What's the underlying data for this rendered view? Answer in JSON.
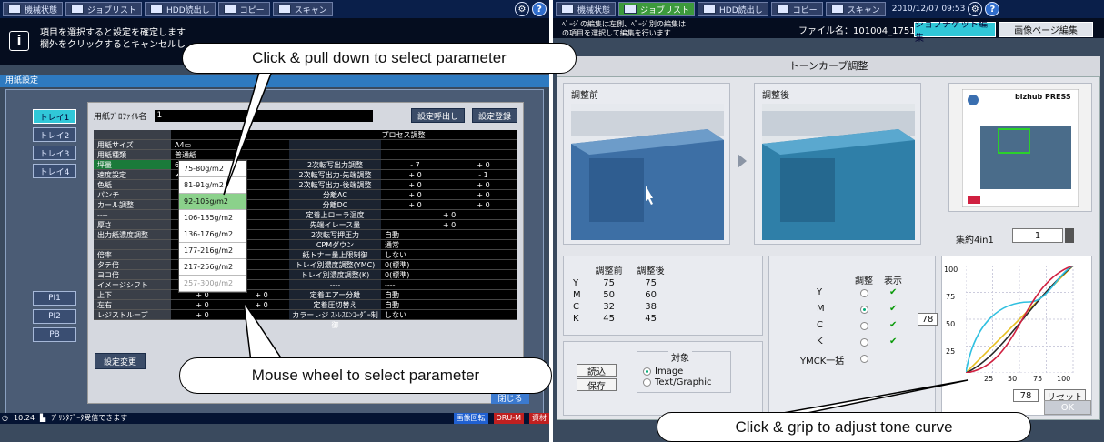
{
  "left": {
    "topbar": {
      "tabs": [
        "機械状態",
        "ジョブリスト",
        "HDD読出し",
        "コピー",
        "スキャン"
      ],
      "icons": [
        "machine-state-icon",
        "job-list-icon",
        "hdd-icon",
        "copy-icon",
        "scan-icon"
      ]
    },
    "message": [
      "項目を選択すると設定を確定します",
      "欄外をクリックするとキャンセルし"
    ],
    "title": "用紙設定",
    "trays": [
      "トレイ1",
      "トレイ2",
      "トレイ3",
      "トレイ4"
    ],
    "pi_buttons": [
      "PI1",
      "PI2",
      "PB"
    ],
    "profile_label": "用紙ﾌﾟﾛﾌｧｲﾙ名",
    "profile_value": "1",
    "call_button": "設定呼出し",
    "register_button": "設定登録",
    "rows": [
      {
        "k": "用紙サイズ",
        "v": "A4▭",
        "p": "",
        "a": "",
        "b": ""
      },
      {
        "k": "用紙種類",
        "v": "普通紙",
        "p": "",
        "a": "",
        "b": ""
      },
      {
        "k": "坪量",
        "v": "62-74g/m2",
        "p": "2次転写出力調整",
        "a": "- 7",
        "b": "+ 0"
      },
      {
        "k": "速度設定",
        "v": "✔62-74g/m2",
        "p": "2次転写出力-先端調整",
        "a": "+ 0",
        "b": "- 1"
      },
      {
        "k": "色紙",
        "v": "",
        "p": "2次転写出力-後端調整",
        "a": "+ 0",
        "b": "+ 0"
      },
      {
        "k": "パンチ",
        "v": "",
        "p": "分離AC",
        "a": "+ 0",
        "b": "+ 0"
      },
      {
        "k": "カール調整",
        "v": "",
        "p": "分離DC",
        "a": "+ 0",
        "b": "+ 0"
      },
      {
        "k": "----",
        "v": "",
        "p": "定着上ローラ温度",
        "ab": "+ 0"
      },
      {
        "k": "厚さ",
        "v": "",
        "p": "先端イレース量",
        "ab": "+ 0"
      },
      {
        "k": "出力紙濃度調整",
        "v": "",
        "p": "2次転写押圧力",
        "w": "自動"
      },
      {
        "k": "",
        "v": "",
        "p": "CPMダウン",
        "w": "通常"
      },
      {
        "k": "倍率",
        "v": "",
        "p": "紙トナー量上限制御",
        "w": "しない"
      },
      {
        "k": "タテ倍",
        "v": "",
        "p": "トレイ別濃度調整(YMC)",
        "w": "0(標準)"
      },
      {
        "k": "ヨコ倍",
        "v": "",
        "p": "トレイ別濃度調整(K)",
        "w": "0(標準)"
      },
      {
        "k": "イメージシフト",
        "v": "",
        "p": "----",
        "w": "----"
      },
      {
        "k": "上下",
        "v": "+ 0",
        "v2": "+ 0",
        "p": "定着エアー分離",
        "w": "自動"
      },
      {
        "k": "左右",
        "v": "+ 0",
        "v2": "+ 0",
        "p": "定着圧切替え",
        "w": "自動"
      },
      {
        "k": "レジストループ",
        "v": "+ 0",
        "v2": "",
        "p": "カラーレジ ｽﾄﾚｽｴﾝｺｰﾀﾞｰ制御",
        "w": "しない"
      }
    ],
    "process_header": "プロセス調整",
    "dropdown": [
      "75-80g/m2",
      "81-91g/m2",
      "92-105g/m2",
      "106-135g/m2",
      "136-176g/m2",
      "177-216g/m2",
      "217-256g/m2",
      "257-300g/m2"
    ],
    "dropdown_highlight": "92-105g/m2",
    "change_button": "設定変更",
    "close_button": "閉じる",
    "status_time": "10:24",
    "status_text": "ﾌﾟﾘﾝﾀﾃﾞｰﾀ受信できます",
    "status_b1": "画像回転",
    "status_b2": "ORU-M",
    "status_b3": "資材"
  },
  "right": {
    "topbar": {
      "tabs": [
        "機械状態",
        "ジョブリスト",
        "HDD読出し",
        "コピー",
        "スキャン"
      ],
      "datetime": "2010/12/07 09:53"
    },
    "message": [
      "ﾍﾟｰｼﾞの編集は左側、ﾍﾟｰｼﾞ別の編集は",
      "の項目を選択して編集を行います"
    ],
    "filename": "ファイル名：101004_175104_",
    "job_tab": "ジョブチケット編集",
    "page_tab": "画像ページ編集",
    "title": "トーンカーブ調整",
    "before_label": "調整前",
    "after_label": "調整後",
    "thumb_label": "bizhub PRESS",
    "nup_label": "集約4in1",
    "nup_value": "1",
    "values_header": [
      "調整前",
      "調整後"
    ],
    "values": [
      {
        "ch": "Y",
        "before": "75",
        "after": "75"
      },
      {
        "ch": "M",
        "before": "50",
        "after": "60"
      },
      {
        "ch": "C",
        "before": "32",
        "after": "38"
      },
      {
        "ch": "K",
        "before": "45",
        "after": "45"
      }
    ],
    "target_label": "対象",
    "target_options": [
      "Image",
      "Text/Graphic"
    ],
    "load_button": "読込",
    "save_button": "保存",
    "adjust_header": [
      "調整",
      "表示"
    ],
    "channels": [
      "Y",
      "M",
      "C",
      "K",
      "YMCK一括"
    ],
    "curve_y_value": "78",
    "curve_x_value": "78",
    "curve_axis": [
      "25",
      "50",
      "75",
      "100"
    ],
    "reset_button": "リセット",
    "ok_button": "OK",
    "curve_colors": {
      "Y": "#e8c020",
      "M": "#d02040",
      "C": "#30c0e0",
      "K": "#2a2a2a"
    }
  },
  "callouts": {
    "pull_down": "Click & pull down to select parameter",
    "wheel": "Mouse wheel to select parameter",
    "tone": "Click & grip to adjust tone curve"
  }
}
